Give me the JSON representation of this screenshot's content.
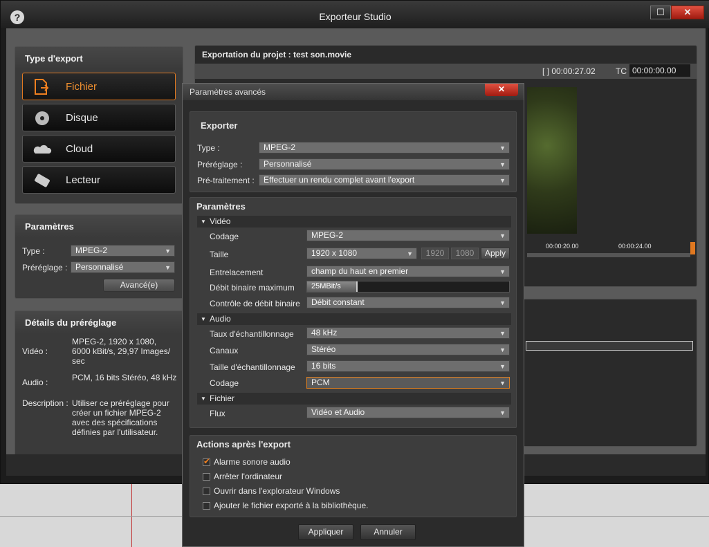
{
  "window": {
    "title": "Exporteur Studio",
    "minimize": "☐",
    "close": "✕",
    "help": "?"
  },
  "export_type": {
    "title": "Type d'export",
    "items": [
      {
        "label": "Fichier",
        "icon": "file-export-icon"
      },
      {
        "label": "Disque",
        "icon": "disc-icon"
      },
      {
        "label": "Cloud",
        "icon": "cloud-icon"
      },
      {
        "label": "Lecteur",
        "icon": "device-icon"
      }
    ]
  },
  "params": {
    "title": "Paramètres",
    "type_label": "Type :",
    "type_value": "MPEG-2",
    "preset_label": "Préréglage :",
    "preset_value": "Personnalisé",
    "advanced_button": "Avancé(e)"
  },
  "preset_details": {
    "title": "Détails du préréglage",
    "video_label": "Vidéo :",
    "video_value": "MPEG-2, 1920 x 1080, 6000 kBit/s, 29,97 Images/ sec",
    "audio_label": "Audio :",
    "audio_value": "PCM, 16 bits Stéréo, 48 kHz",
    "desc_label": "Description :",
    "desc_value": "Utiliser ce préréglage pour créer un fichier MPEG-2 avec des spécifications définies par l'utilisateur."
  },
  "preview": {
    "title": "Exportation du projet : test son.movie",
    "duration": "[ ] 00:00:27.02",
    "tc_label": "TC",
    "tc_value": "00:00:00.00",
    "time1": "00:00:20.00",
    "time2": "00:00:24.00"
  },
  "advanced": {
    "title": "Paramètres avancés",
    "close": "✕",
    "exporter_title": "Exporter",
    "type_label": "Type :",
    "type_value": "MPEG-2",
    "preset_label": "Préréglage :",
    "preset_value": "Personnalisé",
    "preprocess_label": "Pré-traitement :",
    "preprocess_value": "Effectuer un rendu complet avant l'export",
    "params_title": "Paramètres",
    "video_section": "Vidéo",
    "codage_label": "Codage",
    "codage_value": "MPEG-2",
    "size_label": "Taille",
    "size_value": "1920 x 1080",
    "width": "1920",
    "height": "1080",
    "apply": "Apply",
    "interlace_label": "Entrelacement",
    "interlace_value": "champ du haut en premier",
    "bitrate_label": "Débit binaire maximum",
    "bitrate_value": "25MBit/s",
    "bitrate_fraction": 0.25,
    "bitrate_ctrl_label": "Contrôle de débit binaire",
    "bitrate_ctrl_value": "Débit constant",
    "audio_section": "Audio",
    "samplerate_label": "Taux d'échantillonnage",
    "samplerate_value": "48 kHz",
    "channels_label": "Canaux",
    "channels_value": "Stéréo",
    "samplesize_label": "Taille d'échantillonnage",
    "samplesize_value": "16 bits",
    "acodage_label": "Codage",
    "acodage_value": "PCM",
    "file_section": "Fichier",
    "stream_label": "Flux",
    "stream_value": "Vidéo et Audio",
    "actions_title": "Actions après l'export",
    "actions": [
      {
        "label": "Alarme sonore audio",
        "checked": true
      },
      {
        "label": "Arrêter l'ordinateur",
        "checked": false
      },
      {
        "label": "Ouvrir dans l'explorateur Windows",
        "checked": false
      },
      {
        "label": "Ajouter le fichier exporté à la bibliothèque.",
        "checked": false
      }
    ],
    "apply_button": "Appliquer",
    "cancel_button": "Annuler"
  },
  "colors": {
    "accent": "#e07820",
    "close": "#c83020"
  }
}
